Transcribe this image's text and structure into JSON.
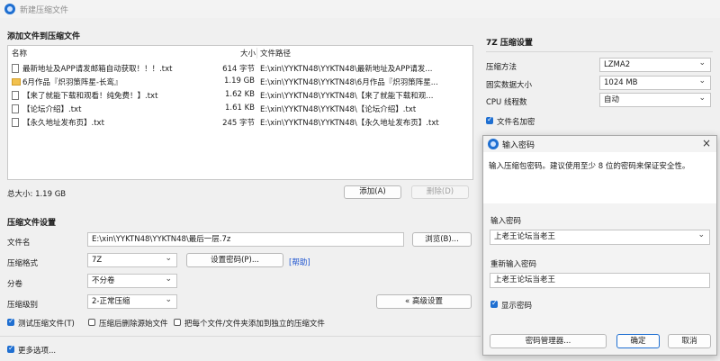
{
  "window": {
    "title": "新建压缩文件"
  },
  "files": {
    "heading": "添加文件到压缩文件",
    "columns": {
      "name": "名称",
      "size": "大小",
      "path": "文件路径"
    },
    "rows": [
      {
        "name": "最新地址及APP请发邮箱自动获取！！！.txt",
        "size": "614 字节",
        "path": "E:\\xin\\YYKTN48\\YYKTN48\\最新地址及APP请发...",
        "type": "file"
      },
      {
        "name": "6月作品『炽羽策阵星-长鸾』",
        "size": "1.19 GB",
        "path": "E:\\xin\\YYKTN48\\YYKTN48\\6月作品『炽羽策阵星...",
        "type": "folder"
      },
      {
        "name": "【来了就能下载和观看！纯免费！】.txt",
        "size": "1.62 KB",
        "path": "E:\\xin\\YYKTN48\\YYKTN48\\【来了就能下载和观...",
        "type": "file"
      },
      {
        "name": "【论坛介绍】.txt",
        "size": "1.61 KB",
        "path": "E:\\xin\\YYKTN48\\YYKTN48\\【论坛介绍】.txt",
        "type": "file"
      },
      {
        "name": "【永久地址发布页】.txt",
        "size": "245 字节",
        "path": "E:\\xin\\YYKTN48\\YYKTN48\\【永久地址发布页】.txt",
        "type": "file"
      }
    ],
    "total": "总大小: 1.19 GB",
    "add_label": "添加(A)",
    "delete_label": "删除(D)"
  },
  "archive": {
    "heading": "压缩文件设置",
    "filename_label": "文件名",
    "filename_value": "E:\\xin\\YYKTN48\\YYKTN48\\最后一层.7z",
    "browse_label": "浏览(B)...",
    "format_label": "压缩格式",
    "format_value": "7Z",
    "set_password_label": "设置密码(P)...",
    "help_label": "[帮助]",
    "split_label": "分卷",
    "split_value": "不分卷",
    "level_label": "压缩级别",
    "level_value": "2-正常压缩",
    "advanced_label": "« 高级设置",
    "test_label": "测试压缩文件(T)",
    "delete_after_label": "压缩后删除源始文件",
    "separate_label": "把每个文件/文件夹添加到独立的压缩文件",
    "more_label": "更多选项..."
  },
  "settings7z": {
    "heading": "7Z 压缩设置",
    "method_label": "压缩方法",
    "method_value": "LZMA2",
    "dict_label": "固实数据大小",
    "dict_value": "1024 MB",
    "threads_label": "CPU 线程数",
    "threads_value": "自动",
    "encrypt_names_label": "文件名加密"
  },
  "password_dialog": {
    "title": "输入密码",
    "close_icon": "×",
    "instruction": "输入压缩包密码。建议使用至少 8 位的密码来保证安全性。",
    "enter_label": "输入密码",
    "enter_value": "上老王论坛当老王",
    "reenter_label": "重新输入密码",
    "reenter_value": "上老王论坛当老王",
    "show_label": "显示密码",
    "manager_label": "密码管理器...",
    "ok_label": "确定",
    "cancel_label": "取消"
  }
}
